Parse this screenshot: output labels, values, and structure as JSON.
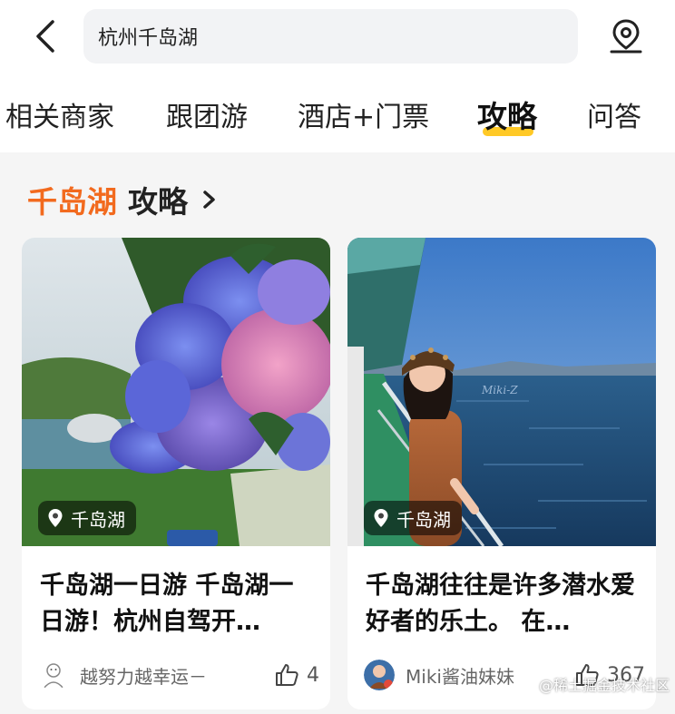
{
  "search": {
    "value": "杭州千岛湖",
    "placeholder": ""
  },
  "tabs": [
    {
      "label": "相关商家"
    },
    {
      "label": "跟团游"
    },
    {
      "label": "酒店+门票"
    },
    {
      "label": "攻略"
    },
    {
      "label": "问答"
    }
  ],
  "active_tab": "攻略",
  "section": {
    "highlight": "千岛湖",
    "label": "攻略"
  },
  "cards": [
    {
      "location": "千岛湖",
      "title": "千岛湖一日游 千岛湖一日游！杭州自驾开…",
      "author": "越努力越幸运－",
      "likes": "4"
    },
    {
      "location": "千岛湖",
      "title": "千岛湖往往是许多潜水爱好者的乐土。 在…",
      "author": "Miki酱油妹妹",
      "likes": "367"
    }
  ],
  "photo_text": "Miki-Z",
  "watermark": "@稀土掘金技术社区",
  "colors": {
    "accent": "#f26a1e",
    "tab_underline": "#ffc926"
  },
  "icons": [
    "back-arrow-icon",
    "location-pin-icon",
    "chevron-right-icon",
    "thumbs-up-icon"
  ]
}
